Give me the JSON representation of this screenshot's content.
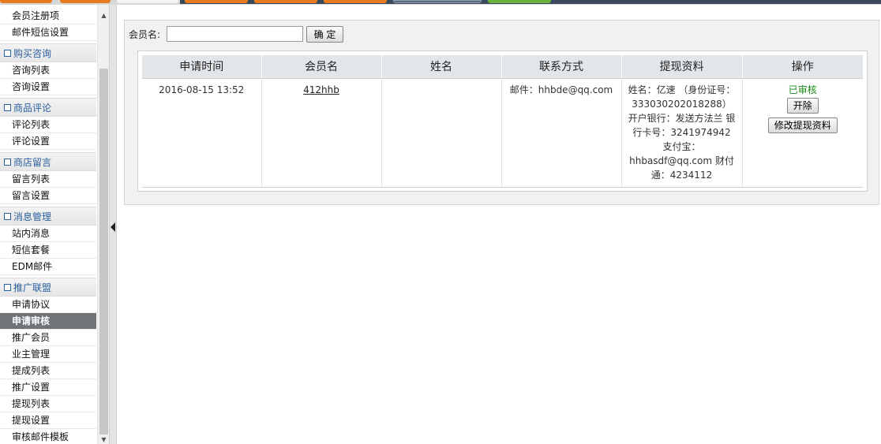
{
  "sidebar": {
    "top_items": [
      "会员注册项",
      "邮件短信设置"
    ],
    "groups": [
      {
        "title": "购买咨询",
        "items": [
          "咨询列表",
          "咨询设置"
        ]
      },
      {
        "title": "商品评论",
        "items": [
          "评论列表",
          "评论设置"
        ]
      },
      {
        "title": "商店留言",
        "items": [
          "留言列表",
          "留言设置"
        ]
      },
      {
        "title": "消息管理",
        "items": [
          "站内消息",
          "短信套餐",
          "EDM邮件"
        ]
      },
      {
        "title": "推广联盟",
        "items": [
          "申请协议",
          "申请审核",
          "推广会员",
          "业主管理",
          "提成列表",
          "推广设置",
          "提现列表",
          "提现设置",
          "审核邮件模板"
        ]
      }
    ],
    "active_item": "申请审核"
  },
  "search": {
    "label": "会员名:",
    "value": "",
    "button": "确 定"
  },
  "table": {
    "headers": [
      "申请时间",
      "会员名",
      "姓名",
      "联系方式",
      "提现资料",
      "操作"
    ],
    "rows": [
      {
        "time": "2016-08-15 13:52",
        "member": "412hhb",
        "name": "",
        "contact": "邮件：hhbde@qq.com",
        "withdraw_info": "姓名：亿速 （身份证号：333030202018288） 开户银行：发送方法兰 银行卡号：3241974942 支付宝：hhbasdf@qq.com 财付通：4234112",
        "status": "已审核",
        "action_open": "开除",
        "action_edit": "修改提现资料"
      }
    ]
  },
  "colors": {
    "accent": "#2a5f9e",
    "active_bg": "#6f7478",
    "status_ok": "#1a8a1a",
    "top_tab_orange": "#e87b1e",
    "top_tab_green": "#6bb33a"
  }
}
